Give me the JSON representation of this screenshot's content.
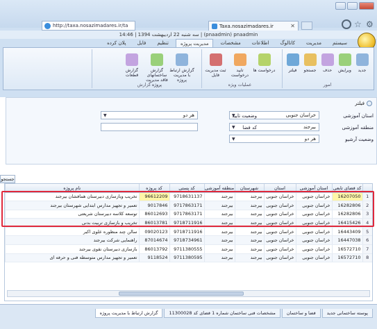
{
  "browser": {
    "address_url": "http://taxa.nosazimadares.ir/ta",
    "tab_title": "Taxa.nosazimadares.ir"
  },
  "app": {
    "window_title": "سه شنبه 22 اردیبهشت 1394 | 14:46 | (pnaadmin) pnaadmin",
    "ribbon_tabs": [
      "سیستم",
      "مدیریت",
      "کاتالوگ",
      "اطلاعات",
      "مشخصات",
      "مدیریت پروژه",
      "تنظیم",
      "فایل",
      "پلان کرده"
    ],
    "active_tab_index": 5,
    "ribbon_groups": [
      {
        "label": "امور",
        "buttons": [
          "جدید",
          "ویرایش",
          "حذف",
          "جستجو",
          "فیلتر"
        ]
      },
      {
        "label": "عملیات ویژه",
        "buttons": [
          "درخواست ها",
          "تایید درخواست",
          "ثبت مدیریت فایل"
        ]
      },
      {
        "label": "گزارش",
        "buttons": [
          "گزارش ارتباط با مدیریت پروژه",
          "گزارش ساختمانهای فاقد مدیریت پروژه",
          "گزارش قطعات"
        ]
      }
    ]
  },
  "filter": {
    "title": "فیلتر",
    "fields": [
      {
        "label": "استان آموزشی",
        "value": "خراسان جنوبی"
      },
      {
        "label": "منطقه آموزشی",
        "value": "بیرجند"
      },
      {
        "label": "وضعیت آرشیو",
        "value": "هر دو"
      },
      {
        "label": "وضعیت تایید",
        "value": "هر دو"
      },
      {
        "label": "کد فضا",
        "value": ""
      }
    ],
    "search_label": "جستجو"
  },
  "grid": {
    "columns": [
      "",
      "کد فضای تابعی",
      "استان آموزشی",
      "استان",
      "شهرستان",
      "منطقه آموزشی",
      "کد پستی",
      "کد پروژه",
      "نام پروژه"
    ],
    "rows": [
      [
        "1",
        "16207050",
        "خراسان جنوبی",
        "خراسان جنوبی",
        "بیرجند",
        "بیرجند",
        "9718631137",
        "96612209",
        "تخریب وبازسازی دبیرستان همافشان بیرجند"
      ],
      [
        "2",
        "16282806",
        "خراسان جنوبی",
        "خراسان جنوبی",
        "بیرجند",
        "بیرجند",
        "9717863171",
        "9017846",
        "تعمیر و تجهیز مدارس ابتدایی شهرستان بیرجند"
      ],
      [
        "3",
        "16282806",
        "خراسان جنوبی",
        "خراسان جنوبی",
        "بیرجند",
        "بیرجند",
        "9717863171",
        "86012693",
        "توسعه کلاسه دبیرستان شریعتی"
      ],
      [
        "4",
        "16415426",
        "خراسان جنوبی",
        "خراسان جنوبی",
        "بیرجند",
        "بیرجند",
        "9718711916",
        "86013781",
        "تخریب و بازسازی تربیت بدنی"
      ],
      [
        "5",
        "16443409",
        "خراسان جنوبی",
        "خراسان جنوبی",
        "بیرجند",
        "بیرجند",
        "9718711916",
        "09020123",
        "سالن چند منظوره علوی اکبر"
      ],
      [
        "6",
        "16447038",
        "خراسان جنوبی",
        "خراسان جنوبی",
        "بیرجند",
        "بیرجند",
        "9718734961",
        "87014674",
        "راهنمایی شرکت بیرجند"
      ],
      [
        "7",
        "16572710",
        "خراسان جنوبی",
        "خراسان جنوبی",
        "بیرجند",
        "بیرجند",
        "9711380555",
        "86013792",
        "بازسازی دبیرستان نقوی بیرجند"
      ],
      [
        "8",
        "16572710",
        "خراسان جنوبی",
        "خراسان جنوبی",
        "بیرجند",
        "بیرجند",
        "9711380595",
        "9118524",
        "تعمیر و تجهیز مدارس متوسطه فنی و حرفه ای"
      ]
    ],
    "highlight_cells": [
      [
        0,
        1
      ],
      [
        0,
        7
      ]
    ]
  },
  "bottom_tabs": [
    "پوسته ساختمانی جدید",
    "فضا و ساختمان",
    "مشخصات فنی ساختمان شماره 1 فضای کد 11300028",
    "گزارش ارتباط با مدیریت پروژه"
  ],
  "colors": {
    "highlight_box": "#e0283b",
    "cell_highlight": "#fff6a8"
  }
}
